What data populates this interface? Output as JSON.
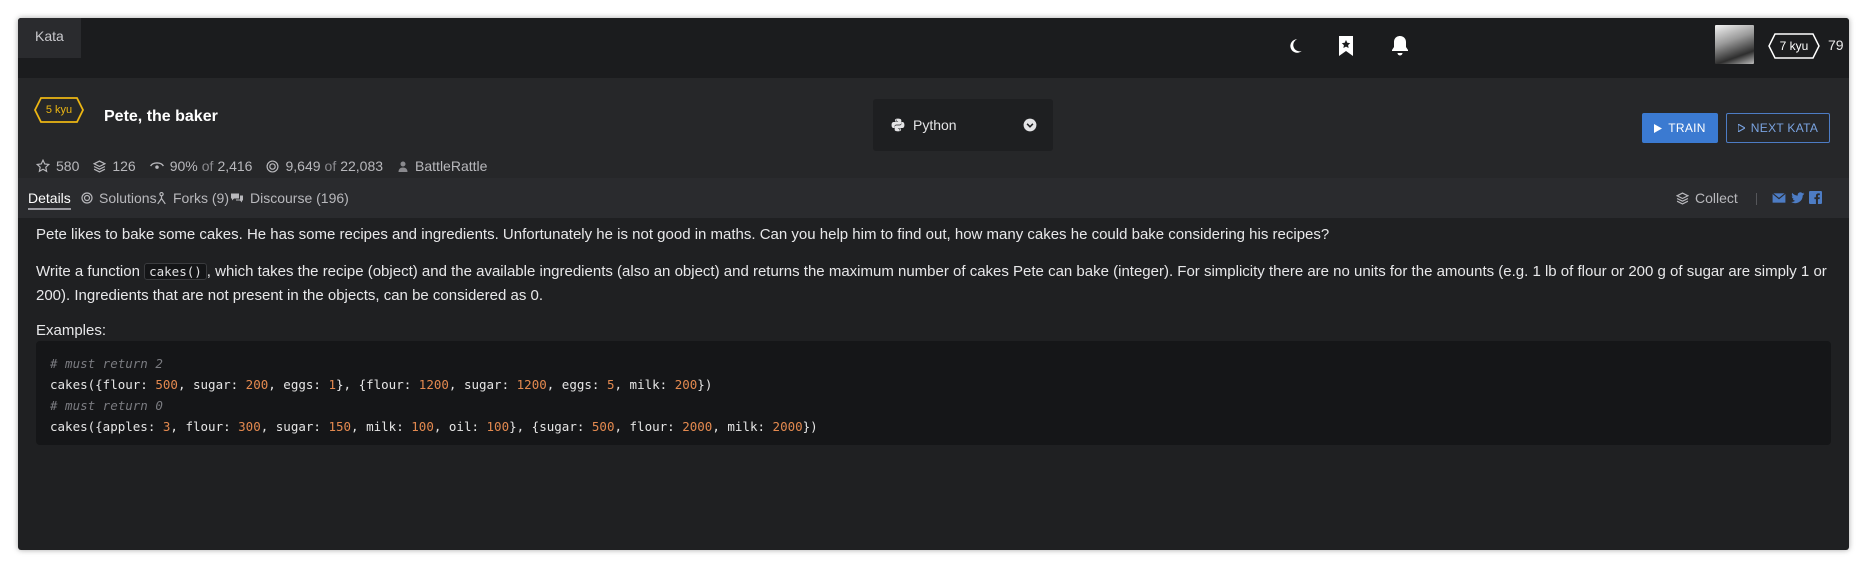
{
  "topbar": {
    "tab_label": "Kata",
    "user_rank": "7 kyu",
    "honor": "79",
    "icons": [
      "moon-icon",
      "bookmark-icon",
      "bell-icon"
    ]
  },
  "kata": {
    "rank": "5 kyu",
    "title": "Pete, the baker",
    "stats": {
      "stars": "580",
      "collections": "126",
      "satisfaction_pct": "90%",
      "satisfaction_of": "of",
      "satisfaction_total": "2,416",
      "completed": "9,649",
      "completed_of": "of",
      "attempted": "22,083",
      "author": "BattleRattle"
    },
    "language": "Python",
    "train_label": "TRAIN",
    "next_label": "NEXT KATA"
  },
  "tabs": {
    "details": "Details",
    "solutions": "Solutions",
    "forks": "Forks (9)",
    "discourse": "Discourse (196)",
    "collect": "Collect"
  },
  "description": {
    "p1": "Pete likes to bake some cakes. He has some recipes and ingredients. Unfortunately he is not good in maths. Can you help him to find out, how many cakes he could bake considering his recipes?",
    "p2_before": "Write a function ",
    "p2_code": "cakes()",
    "p2_after": ", which takes the recipe (object) and the available ingredients (also an object) and returns the maximum number of cakes Pete can bake (integer). For simplicity there are no units for the amounts (e.g. 1 lb of flour or 200 g of sugar are simply 1 or 200). Ingredients that are not present in the objects, can be considered as 0.",
    "examples_label": "Examples:"
  },
  "code_example": {
    "comment1": "# must return 2",
    "line1": [
      {
        "t": "cakes({flour: ",
        "k": "plain"
      },
      {
        "t": "500",
        "k": "num"
      },
      {
        "t": ", sugar: ",
        "k": "plain"
      },
      {
        "t": "200",
        "k": "num"
      },
      {
        "t": ", eggs: ",
        "k": "plain"
      },
      {
        "t": "1",
        "k": "num"
      },
      {
        "t": "}, {flour: ",
        "k": "plain"
      },
      {
        "t": "1200",
        "k": "num"
      },
      {
        "t": ", sugar: ",
        "k": "plain"
      },
      {
        "t": "1200",
        "k": "num"
      },
      {
        "t": ", eggs: ",
        "k": "plain"
      },
      {
        "t": "5",
        "k": "num"
      },
      {
        "t": ", milk: ",
        "k": "plain"
      },
      {
        "t": "200",
        "k": "num"
      },
      {
        "t": "})",
        "k": "plain"
      }
    ],
    "comment2": "# must return 0",
    "line2": [
      {
        "t": "cakes({apples: ",
        "k": "plain"
      },
      {
        "t": "3",
        "k": "num"
      },
      {
        "t": ", flour: ",
        "k": "plain"
      },
      {
        "t": "300",
        "k": "num"
      },
      {
        "t": ", sugar: ",
        "k": "plain"
      },
      {
        "t": "150",
        "k": "num"
      },
      {
        "t": ", milk: ",
        "k": "plain"
      },
      {
        "t": "100",
        "k": "num"
      },
      {
        "t": ", oil: ",
        "k": "plain"
      },
      {
        "t": "100",
        "k": "num"
      },
      {
        "t": "}, {sugar: ",
        "k": "plain"
      },
      {
        "t": "500",
        "k": "num"
      },
      {
        "t": ", flour: ",
        "k": "plain"
      },
      {
        "t": "2000",
        "k": "num"
      },
      {
        "t": ", milk: ",
        "k": "plain"
      },
      {
        "t": "2000",
        "k": "num"
      },
      {
        "t": "})",
        "k": "plain"
      }
    ]
  },
  "colors": {
    "rank_yellow": "#ecb613",
    "accent_blue": "#3b7ad1",
    "number_orange": "#e3894f"
  }
}
